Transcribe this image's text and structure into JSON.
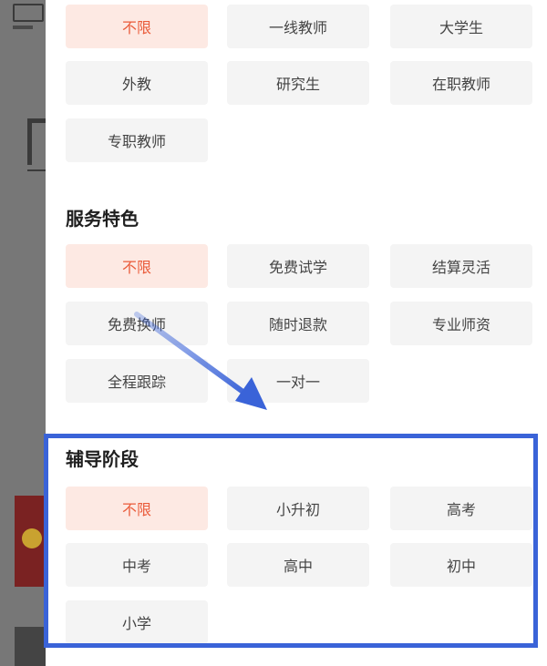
{
  "teacher_type": {
    "options": [
      {
        "label": "不限",
        "selected": true
      },
      {
        "label": "一线教师",
        "selected": false
      },
      {
        "label": "大学生",
        "selected": false
      },
      {
        "label": "外教",
        "selected": false
      },
      {
        "label": "研究生",
        "selected": false
      },
      {
        "label": "在职教师",
        "selected": false
      },
      {
        "label": "专职教师",
        "selected": false
      }
    ]
  },
  "service": {
    "title": "服务特色",
    "options": [
      {
        "label": "不限",
        "selected": true
      },
      {
        "label": "免费试学",
        "selected": false
      },
      {
        "label": "结算灵活",
        "selected": false
      },
      {
        "label": "免费换师",
        "selected": false
      },
      {
        "label": "随时退款",
        "selected": false
      },
      {
        "label": "专业师资",
        "selected": false
      },
      {
        "label": "全程跟踪",
        "selected": false
      },
      {
        "label": "一对一",
        "selected": false
      }
    ]
  },
  "stage": {
    "title": "辅导阶段",
    "options": [
      {
        "label": "不限",
        "selected": true
      },
      {
        "label": "小升初",
        "selected": false
      },
      {
        "label": "高考",
        "selected": false
      },
      {
        "label": "中考",
        "selected": false
      },
      {
        "label": "高中",
        "selected": false
      },
      {
        "label": "初中",
        "selected": false
      },
      {
        "label": "小学",
        "selected": false
      }
    ]
  },
  "colors": {
    "selected_text": "#ea5b3a",
    "selected_bg": "#fde9e3",
    "annotation": "#3a63d8"
  }
}
